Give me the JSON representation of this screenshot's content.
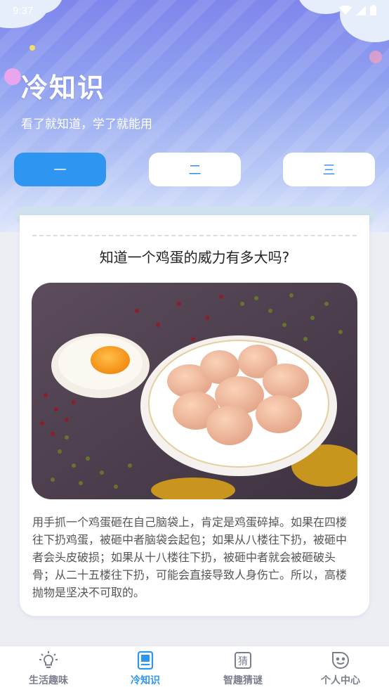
{
  "status": {
    "time": "9:37"
  },
  "header": {
    "title": "冷知识",
    "subtitle": "看了就知道，学了就能用"
  },
  "tabs": [
    {
      "label": "一",
      "active": true
    },
    {
      "label": "二",
      "active": false
    },
    {
      "label": "三",
      "active": false
    }
  ],
  "card": {
    "question": "知道一个鸡蛋的威力有多大吗?",
    "image_description_icon": "eggs-photo",
    "body": "用手抓一个鸡蛋砸在自己脑袋上，肯定是鸡蛋碎掉。如果在四楼往下扔鸡蛋，被砸中者脑袋会起包；如果从八楼往下扔，被砸中者会头皮破损；如果从十八楼往下扔，被砸中者就会被砸破头骨；从二十五楼往下扔，可能会直接导致人身伤亡。所以，高楼抛物是坚决不可取的。"
  },
  "bottom_nav": [
    {
      "label": "生活趣味",
      "icon": "lightbulb-icon",
      "active": false
    },
    {
      "label": "冷知识",
      "icon": "book-icon",
      "active": true
    },
    {
      "label": "智趣猜谜",
      "icon": "guess-icon",
      "active": false
    },
    {
      "label": "个人中心",
      "icon": "smiley-icon",
      "active": false
    }
  ],
  "colors": {
    "accent": "#2e95f0",
    "hero_top": "#7f86ec",
    "hero_bottom": "#dfe6fb"
  }
}
